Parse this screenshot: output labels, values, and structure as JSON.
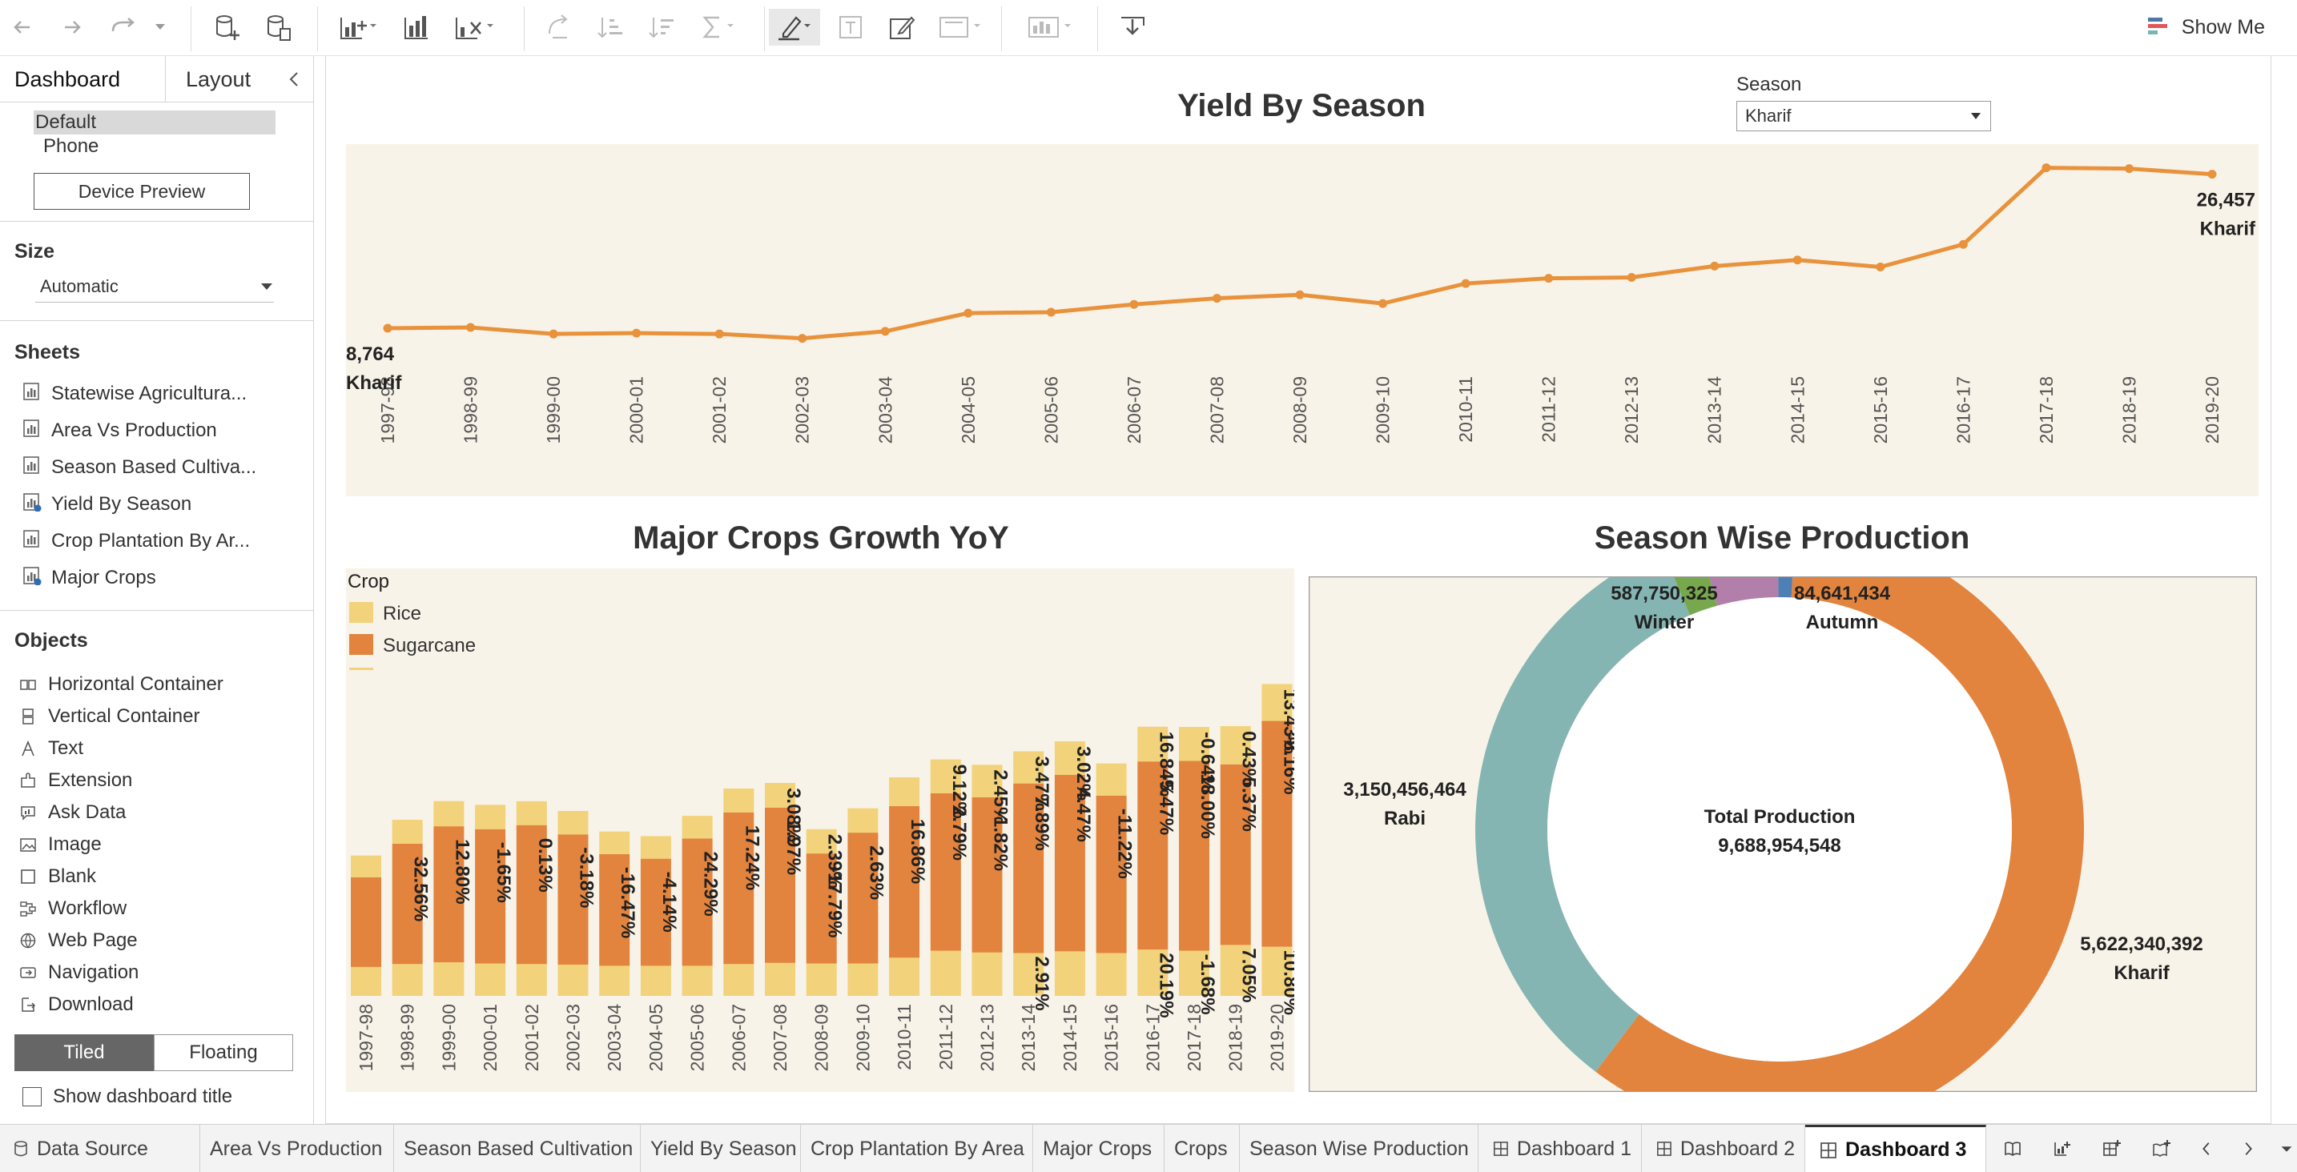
{
  "toolbar": {
    "show_me_label": "Show Me",
    "icons": [
      "undo-icon",
      "redo-icon",
      "replay-icon",
      "dropdown-icon",
      "new-datasource-icon",
      "datasource-icon",
      "new-worksheet-icon",
      "duplicate-icon",
      "clear-icon",
      "swap-icon",
      "sort-asc-icon",
      "sort-desc-icon",
      "totals-icon",
      "highlight-icon",
      "label-icon",
      "annotate-icon",
      "fit-icon",
      "show-cards-icon",
      "present-icon"
    ]
  },
  "left_panel": {
    "tabs": [
      "Dashboard",
      "Layout"
    ],
    "device_options": [
      "Default",
      "Phone"
    ],
    "device_preview_label": "Device Preview",
    "size_title": "Size",
    "size_value": "Automatic",
    "sheets_title": "Sheets",
    "sheets": [
      "Statewise Agricultura...",
      "Area Vs Production",
      "Season Based Cultiva...",
      "Yield By Season",
      "Crop Plantation By Ar...",
      "Major Crops"
    ],
    "objects_title": "Objects",
    "objects": [
      "Horizontal Container",
      "Vertical Container",
      "Text",
      "Extension",
      "Ask Data",
      "Image",
      "Blank",
      "Workflow",
      "Web Page",
      "Navigation",
      "Download"
    ],
    "layout_toggle": [
      "Tiled",
      "Floating"
    ],
    "show_title_label": "Show dashboard title"
  },
  "filter": {
    "label": "Season",
    "value": "Kharif"
  },
  "bottom_tabs": [
    "Data Source",
    "Area Vs Production",
    "Season Based Cultivation",
    "Yield By Season",
    "Crop Plantation By Area",
    "Major Crops",
    "Crops",
    "Season Wise Production",
    "Dashboard 1",
    "Dashboard 2",
    "Dashboard 3"
  ],
  "active_tab": "Dashboard 3",
  "colors": {
    "accent_orange": "#E8923C",
    "chart_bg": "#F8F3E8",
    "rice": "#F2D27A",
    "sugarcane": "#E2843E",
    "rabi": "#85B5B2",
    "winter": "#78A84E",
    "autumn": "#4E7FB5",
    "mauve": "#B27FAA"
  },
  "chart_data": [
    {
      "type": "line",
      "title": "Yield By Season",
      "x": [
        "1997-98",
        "1998-99",
        "1999-00",
        "2000-01",
        "2001-02",
        "2002-03",
        "2003-04",
        "2004-05",
        "2005-06",
        "2006-07",
        "2007-08",
        "2008-09",
        "2009-10",
        "2010-11",
        "2011-12",
        "2012-13",
        "2013-14",
        "2014-15",
        "2015-16",
        "2016-17",
        "2017-18",
        "2018-19",
        "2019-20"
      ],
      "series": [
        {
          "name": "Kharif",
          "values": [
            8764,
            8850,
            8100,
            8200,
            8100,
            7600,
            8400,
            10500,
            10600,
            11500,
            12200,
            12600,
            11600,
            13900,
            14500,
            14600,
            15900,
            16600,
            15800,
            18400,
            27200,
            27100,
            26457
          ]
        }
      ],
      "annotations": [
        {
          "label": "8,764",
          "sub": "Kharif"
        },
        {
          "label": "26,457",
          "sub": "Kharif"
        }
      ],
      "ylim": [
        6000,
        29000
      ]
    },
    {
      "type": "bar",
      "title": "Major Crops Growth YoY",
      "legend_title": "Crop",
      "categories": [
        "1997-98",
        "1998-99",
        "1999-00",
        "2000-01",
        "2001-02",
        "2002-03",
        "2003-04",
        "2004-05",
        "2005-06",
        "2006-07",
        "2007-08",
        "2008-09",
        "2009-10",
        "2010-11",
        "2011-12",
        "2012-13",
        "2013-14",
        "2014-15",
        "2015-16",
        "2016-17",
        "2017-18",
        "2018-19",
        "2019-20"
      ],
      "series": [
        {
          "name": "Rice",
          "values": [
            50,
            55,
            58,
            56,
            55,
            54,
            52,
            52,
            52,
            55,
            57,
            56,
            56,
            66,
            78,
            75,
            74,
            77,
            74,
            80,
            78,
            88,
            85
          ]
        },
        {
          "name": "Sugarcane",
          "values": [
            155,
            208,
            235,
            232,
            240,
            225,
            193,
            185,
            220,
            262,
            268,
            190,
            226,
            262,
            272,
            268,
            293,
            305,
            272,
            325,
            328,
            312,
            390
          ]
        }
      ],
      "labels_sugarcane": [
        "",
        "32.56%",
        "12.80%",
        "-1.65%",
        "0.13%",
        "-3.18%",
        "-16.47%",
        "-4.14%",
        "24.29%",
        "17.24%",
        "1.97%",
        "-17.79%",
        "2.63%",
        "16.86%",
        "2.79%",
        "-1.82%",
        "7.89%",
        "4.47%",
        "-11.22%",
        "-5.47%",
        "18.00%",
        "5.37%",
        "-8.16%"
      ],
      "labels_top": [
        "",
        "",
        "",
        "",
        "",
        "",
        "",
        "",
        "",
        "",
        "3.08%",
        "2.39%",
        "",
        "",
        "9.12%",
        "2.45%",
        "3.47%",
        "3.02%",
        "",
        "16.84%",
        "-0.64%",
        "0.43%",
        "13.43%"
      ],
      "labels_rice": [
        "",
        "",
        "",
        "",
        "",
        "",
        "",
        "",
        "",
        "",
        "",
        "",
        "",
        "",
        "",
        "",
        "2.91%",
        "",
        "",
        "20.19%",
        "-1.68%",
        "7.05%",
        "10.80%"
      ],
      "ylim": [
        0,
        650
      ]
    },
    {
      "type": "pie",
      "title": "Season Wise Production",
      "center_label": "Total Production",
      "center_value": "9,688,954,548",
      "slices": [
        {
          "name": "Kharif",
          "value": 5622340392,
          "label": "5,622,340,392"
        },
        {
          "name": "Rabi",
          "value": 3150456464,
          "label": "3,150,456,464"
        },
        {
          "name": "Winter",
          "value": 587750325,
          "label": "587,750,325"
        },
        {
          "name": "Autumn",
          "value": 84641434,
          "label": "84,641,434"
        }
      ]
    }
  ]
}
